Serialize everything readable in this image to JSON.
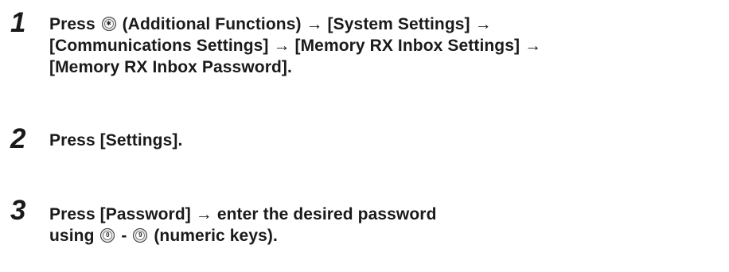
{
  "steps": [
    {
      "number": "1",
      "lines": [
        {
          "pre": "Press ",
          "icon": "additional-functions-key-icon",
          "post": " (Additional Functions) → [System Settings] →"
        },
        {
          "text": "[Communications Settings] → [Memory RX Inbox Settings] →"
        },
        {
          "text": "[Memory RX Inbox Password]."
        }
      ]
    },
    {
      "number": "2",
      "lines": [
        {
          "text": "Press [Settings]."
        }
      ]
    },
    {
      "number": "3",
      "lines": [
        {
          "text": "Press [Password] → enter the desired password"
        },
        {
          "pre": "using ",
          "icon_start": "numeric-key-0-icon",
          "icon_start_glyph": "0",
          "middle": " - ",
          "icon_end": "numeric-key-9-icon",
          "icon_end_glyph": "9",
          "post": " (numeric keys)."
        }
      ]
    }
  ]
}
